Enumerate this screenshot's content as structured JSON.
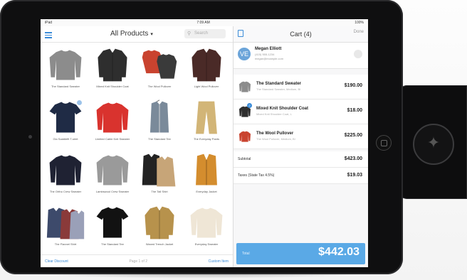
{
  "status": {
    "carrier": "iPad",
    "time": "7:09 AM",
    "battery": "100%"
  },
  "library": {
    "title": "All Products",
    "search_placeholder": "Search",
    "items": [
      {
        "name": "The Standard Sweater",
        "shape": "sweater",
        "color": "#8c8c8c"
      },
      {
        "name": "Mixed Knit Shoulder Coat",
        "shape": "coat",
        "color": "#2e2e2e"
      },
      {
        "name": "The Wool Pullover",
        "shape": "pullover-pair",
        "color": "#c9432f"
      },
      {
        "name": "Light Wool Pullover",
        "shape": "coat",
        "color": "#4a2a27"
      },
      {
        "name": "Gio Saddlefit T-shirt",
        "shape": "tshirt",
        "color": "#1f2b45"
      },
      {
        "name": "Limited Cable Knit Sweater",
        "shape": "sweater",
        "color": "#d9332e"
      },
      {
        "name": "The Standard Tee",
        "shape": "shirt",
        "color": "#7a8a9a"
      },
      {
        "name": "The Everyday Pants",
        "shape": "pants",
        "color": "#d2b577"
      },
      {
        "name": "The Ortho Crew Sweater",
        "shape": "sweater",
        "color": "#1f2233"
      },
      {
        "name": "Lambswool Crew Sweater",
        "shape": "sweater",
        "color": "#9a9a9a"
      },
      {
        "name": "The Tall Shirt",
        "shape": "jackets",
        "color": "#222222"
      },
      {
        "name": "Everyday Jacket",
        "shape": "vest",
        "color": "#d48d2e"
      },
      {
        "name": "The Flannel Shirt",
        "shape": "shirts",
        "color": "#3d4a6b"
      },
      {
        "name": "The Standard Tee",
        "shape": "tshirt",
        "color": "#121212"
      },
      {
        "name": "Waxed Trench Jacket",
        "shape": "coat",
        "color": "#b7924c"
      },
      {
        "name": "Everyday Sweater",
        "shape": "sweater",
        "color": "#efe6d6"
      }
    ],
    "footer_left": "Clear Discount",
    "footer_center": "Page 1 of 2",
    "footer_right": "Custom Item"
  },
  "cart": {
    "title": "Cart (4)",
    "more_label": "Done",
    "customer": {
      "initials": "VE",
      "name": "Megan Elliott",
      "line1": "(415) 555-1234",
      "line2": "megan@example.com"
    },
    "items": [
      {
        "name": "The Standard Sweater",
        "sub": "The Standard Sweater, Medium, Bl",
        "price": "$190.00",
        "qty": "",
        "color": "#8c8c8c"
      },
      {
        "name": "Mixed Knit Shoulder Coat",
        "sub": "Mixed Knit Shoulder Coat, L",
        "price": "$18.00",
        "qty": "2",
        "color": "#2e2e2e"
      },
      {
        "name": "The Wool Pullover",
        "sub": "The Wool Pullover, Medium, Bl",
        "price": "$225.00",
        "qty": "",
        "color": "#c9432f"
      }
    ],
    "subtotal_label": "Subtotal",
    "subtotal": "$423.00",
    "tax_label": "Taxes (State Tax 4.5%)",
    "tax": "$19.03",
    "charge_label": "Total",
    "charge_amount": "$442.03"
  },
  "colors": {
    "accent": "#3a8bd8",
    "charge": "#5aa9e6",
    "bezel": "#0f0f10"
  }
}
